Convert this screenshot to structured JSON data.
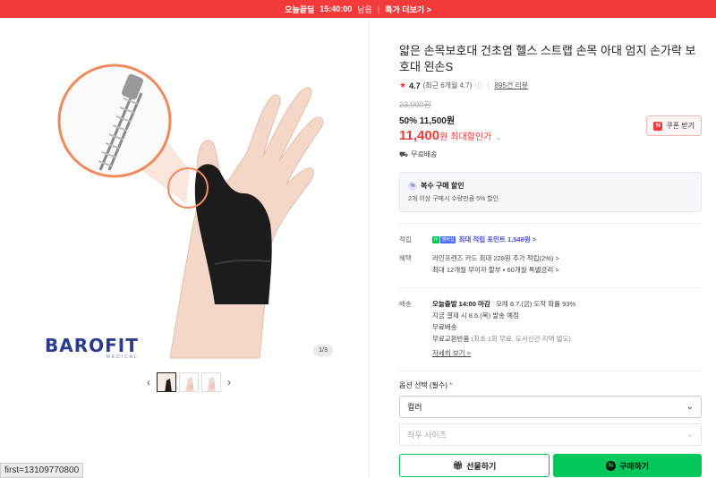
{
  "banner": {
    "today_label": "오늘끝딜",
    "remaining_time": "15:40:00",
    "remaining_suffix": "남음",
    "more_label": "특가 더보기 >"
  },
  "gallery": {
    "brand": "BAROFIT",
    "brand_sub": "MEDICAL",
    "pager": "1/3",
    "prev_icon": "chevron-left-icon",
    "next_icon": "chevron-right-icon",
    "thumbnail_count": 3
  },
  "debug_text": "first=13109770800",
  "product": {
    "title": "얇은 손목보호대 건초염 헬스 스트랩 손목 아대 엄지 손가락 보호대 왼손S",
    "rating_score": "4.7",
    "rating_recent": "(최근 6개월 4.7)",
    "reviews": "895건 리뷰",
    "original_price": "23,000원",
    "sale_price": "50% 11,500원",
    "max_discount_price": "11,400",
    "won": "원",
    "max_discount_label": "최대할인가",
    "coupon_label": "쿠폰 받기",
    "shipping": "무료배송"
  },
  "multi_buy": {
    "title": "복수 구매 할인",
    "desc": "2개 이상 구매시 수량만큼 5% 할인"
  },
  "points": {
    "key": "적립",
    "badge_n": "N",
    "badge_plus": "멤버십",
    "text": "최대 적립 포인트 1,548원 >"
  },
  "benefits": {
    "key": "혜택",
    "line1": "라인프렌즈 카드 최대 228원 추가 적립(2%) >",
    "line2": "최대 12개월 무이자 할부 • 60개월 특별금리 >"
  },
  "delivery": {
    "key": "배송",
    "line1_bold": "오늘출발 14:00 마감",
    "line1_rest": "모레 8.7.(금) 도착 확률 93%",
    "line2": "지금 결제 시 8.6.(목) 발송 예정",
    "line3": "무료배송",
    "line4_main": "무료교환반품",
    "line4_sub": "(최초 1회 무료, 도서산간 지역 별도)",
    "detail_link": "자세히 보기 >"
  },
  "options": {
    "label": "옵션 선택 (필수)",
    "required_mark": "*",
    "color_value": "컬러",
    "size_placeholder": "좌우 사이즈"
  },
  "actions": {
    "gift_label": "선물하기",
    "buy_label": "구매하기"
  },
  "colors": {
    "brand_red": "#f23a3a",
    "naver_green": "#03c75a",
    "barofit_navy": "#2b3b8f"
  }
}
